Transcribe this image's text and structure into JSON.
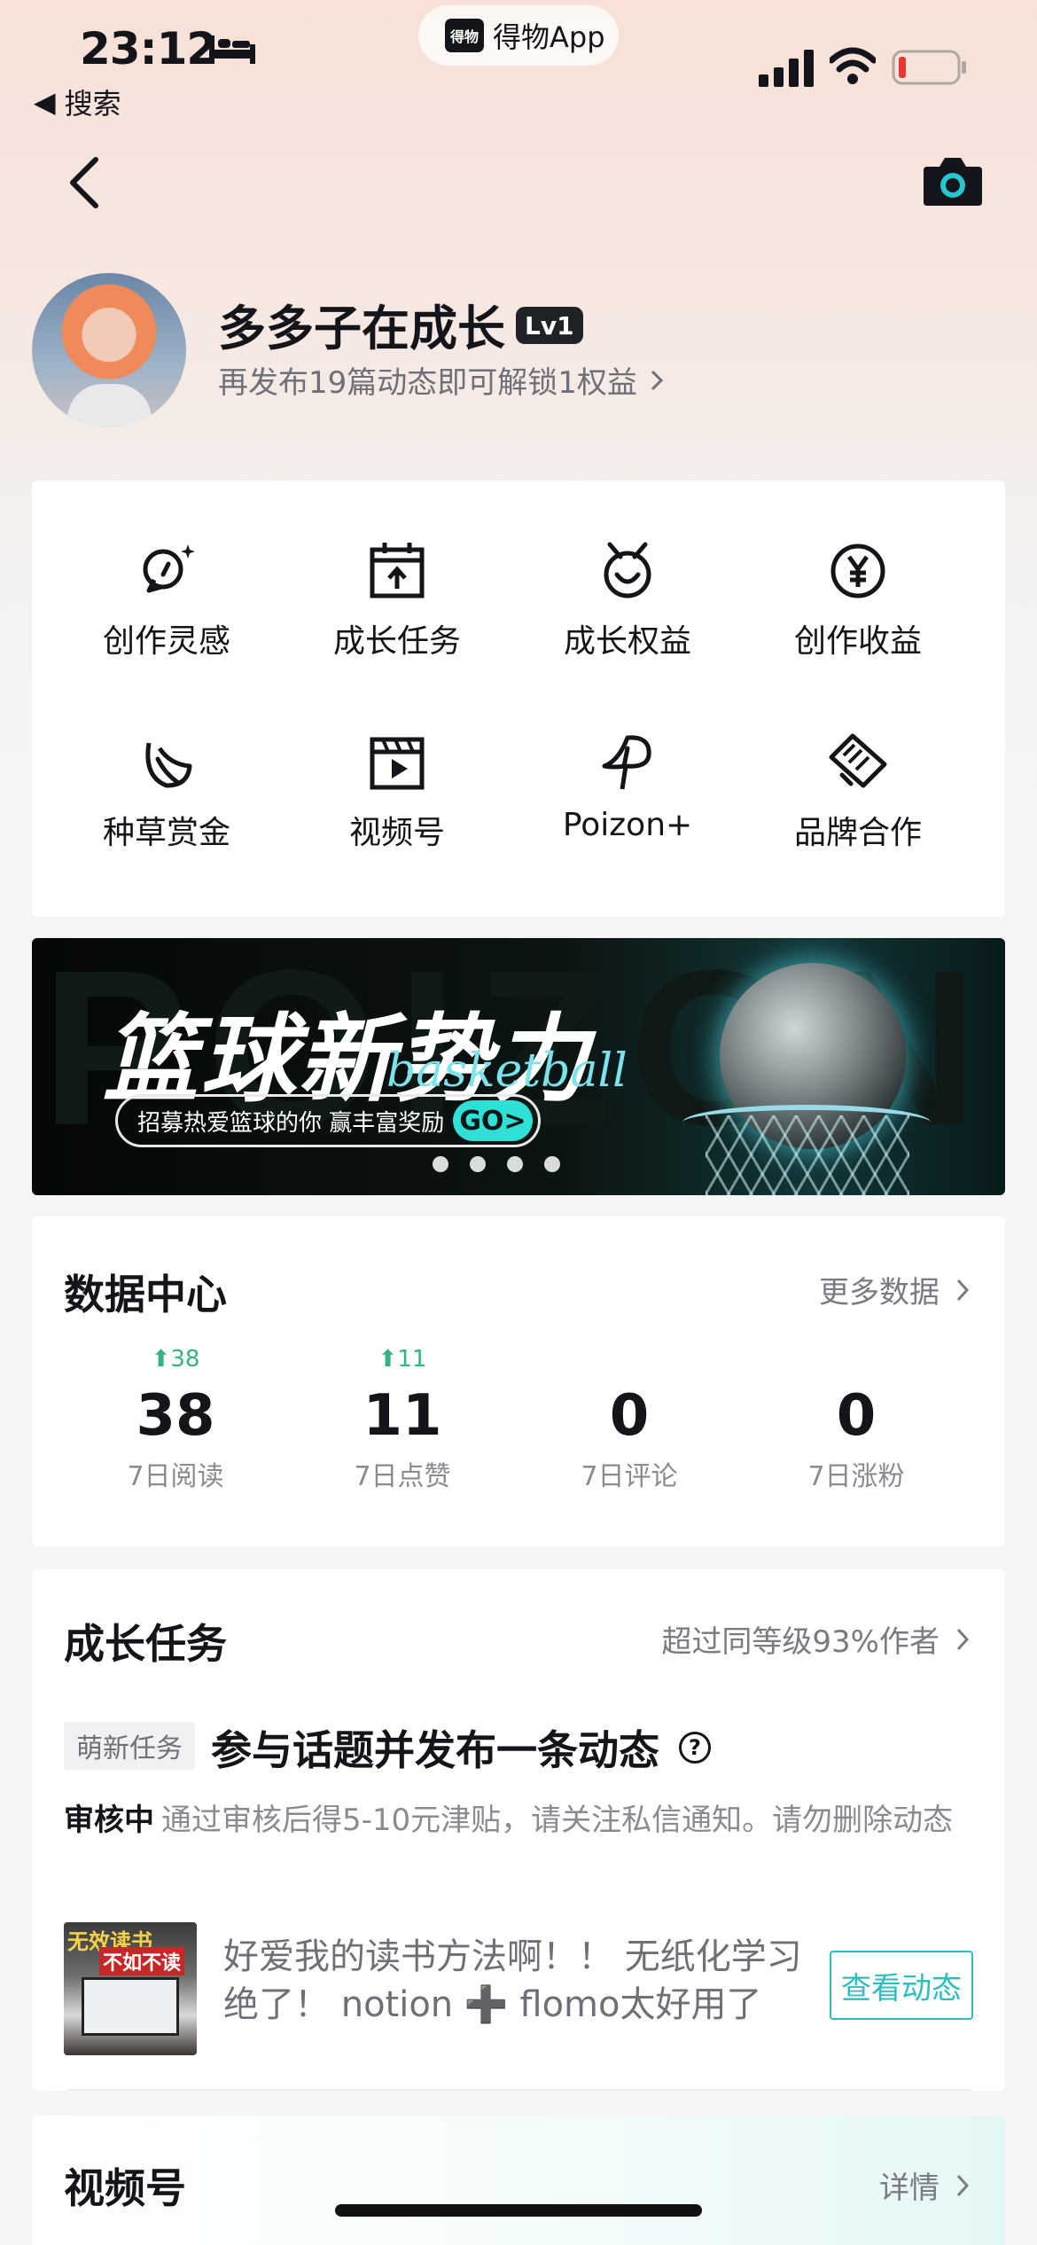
{
  "status": {
    "time": "23:12",
    "app_pill": "得物App",
    "app_logo_text": "得物",
    "back_app": "搜索"
  },
  "profile": {
    "nickname": "多多子在成长",
    "level": "Lv1",
    "unlock_hint": "再发布19篇动态即可解锁1权益"
  },
  "tools": [
    {
      "label": "创作灵感",
      "icon": "lightbulb-icon"
    },
    {
      "label": "成长任务",
      "icon": "calendar-upload-icon"
    },
    {
      "label": "成长权益",
      "icon": "medal-icon"
    },
    {
      "label": "创作收益",
      "icon": "yen-coin-icon"
    },
    {
      "label": "种草赏金",
      "icon": "leaf-icon"
    },
    {
      "label": "视频号",
      "icon": "video-clapper-icon"
    },
    {
      "label": "Poizon+",
      "icon": "poizon-icon"
    },
    {
      "label": "品牌合作",
      "icon": "handshake-icon"
    }
  ],
  "banner": {
    "headline": "篮球新势力",
    "script": "basketball",
    "subline": "招募热爱篮球的你 赢丰富奖励",
    "go": "GO>",
    "bg_word": "POIZON",
    "page_count": 4
  },
  "data_center": {
    "title": "数据中心",
    "more": "更多数据",
    "stats": [
      {
        "delta": "⬆38",
        "value": "38",
        "caption": "7日阅读"
      },
      {
        "delta": "⬆11",
        "value": "11",
        "caption": "7日点赞"
      },
      {
        "delta": "",
        "value": "0",
        "caption": "7日评论"
      },
      {
        "delta": "",
        "value": "0",
        "caption": "7日涨粉"
      }
    ]
  },
  "growth": {
    "title": "成长任务",
    "more": "超过同等级93%作者",
    "tag": "萌新任务",
    "task_title": "参与话题并发布一条动态",
    "review_status": "审核中",
    "review_text": "通过审核后得5-10元津贴，请关注私信通知。请勿删除动态",
    "thumb_line1": "无效读书",
    "thumb_line2": "不如不读",
    "post_text": "好爱我的读书方法啊！！ 无纸化学习绝了！ notion ➕ flomo太好用了",
    "view_button": "查看动态"
  },
  "video": {
    "title": "视频号",
    "more": "详情"
  },
  "colors": {
    "accent_teal": "#2cbfbf",
    "increase_green": "#36b37e"
  }
}
